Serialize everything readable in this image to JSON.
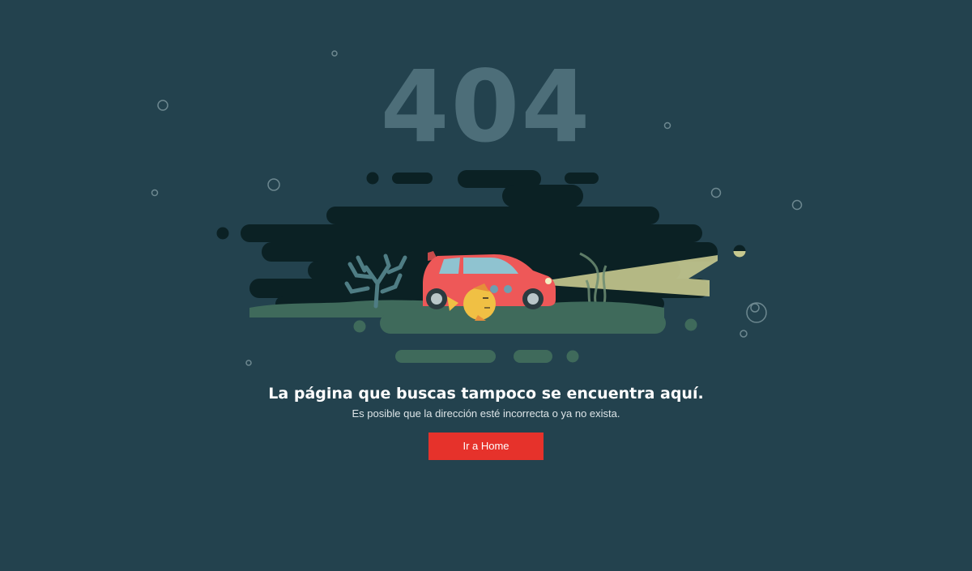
{
  "error": {
    "code": "404"
  },
  "message": {
    "title": "La página que buscas tampoco se encuentra aquí.",
    "subtitle": "Es posible que la dirección esté incorrecta o ya no exista."
  },
  "actions": {
    "home_label": "Ir a Home"
  },
  "colors": {
    "background": "#23424e",
    "error_code": "#4d6e79",
    "water": "#0b2124",
    "seabed": "#3f6a5b",
    "car": "#ee5858",
    "fish": "#f0c044",
    "headlight_beam": "#c7c98f",
    "button": "#e6322b"
  }
}
